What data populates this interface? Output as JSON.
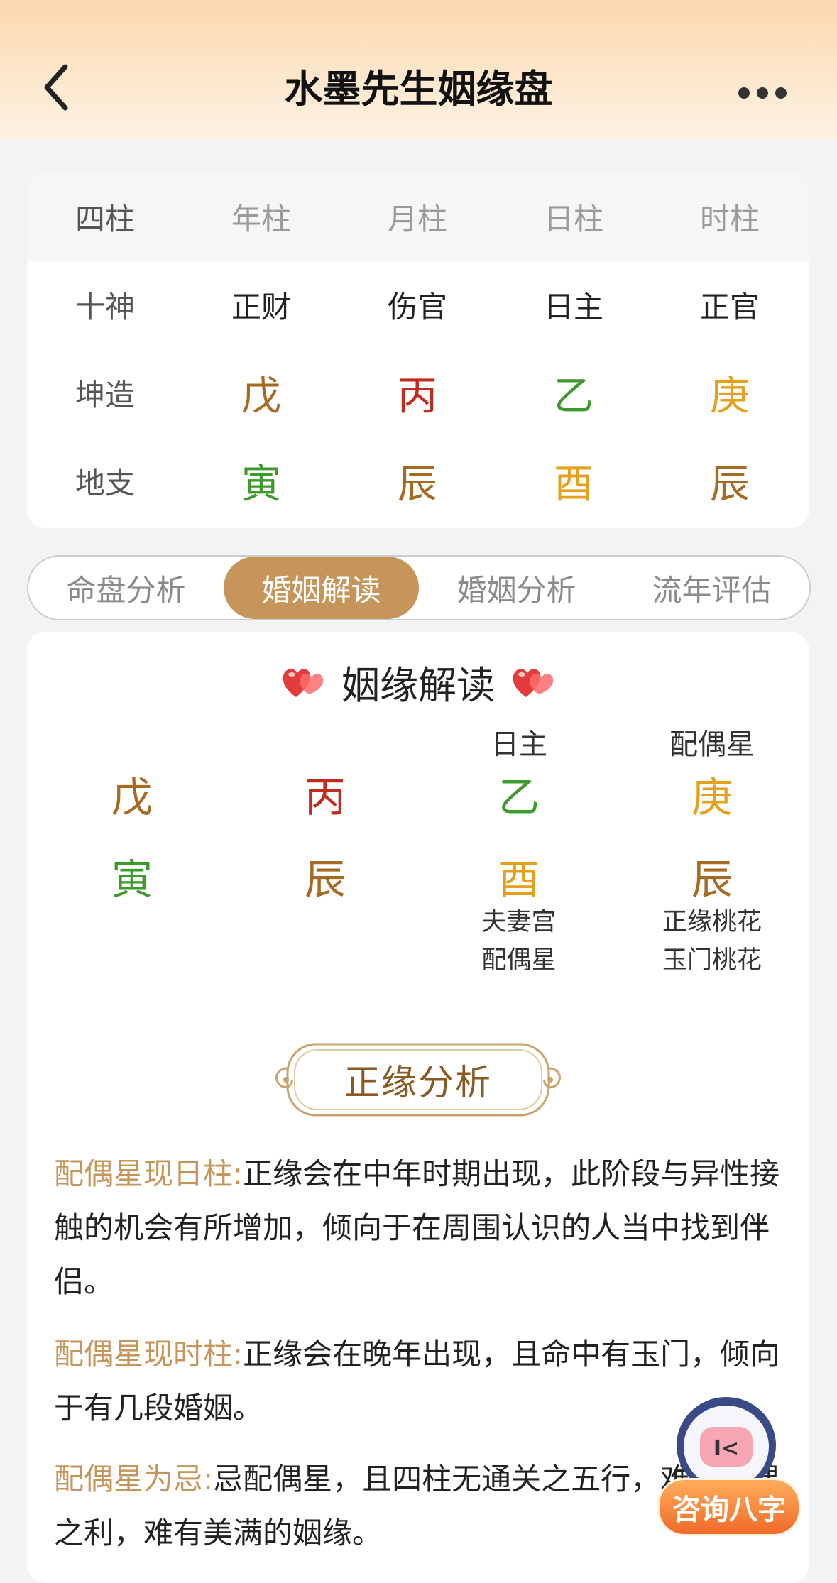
{
  "header": {
    "title": "水墨先生姻缘盘"
  },
  "bazi": {
    "headers": [
      "四柱",
      "年柱",
      "月柱",
      "日柱",
      "时柱"
    ],
    "rows": [
      {
        "label": "十神",
        "cells": [
          "正财",
          "伤官",
          "日主",
          "正官"
        ],
        "colors": [
          "#222222",
          "#222222",
          "#222222",
          "#222222"
        ]
      },
      {
        "label": "坤造",
        "cells": [
          "戊",
          "丙",
          "乙",
          "庚"
        ],
        "colors": [
          "#a66a22",
          "#c42b1f",
          "#3e9a2c",
          "#e6a11c"
        ]
      },
      {
        "label": "地支",
        "cells": [
          "寅",
          "辰",
          "酉",
          "辰"
        ],
        "colors": [
          "#3e9a2c",
          "#a66a22",
          "#e6a11c",
          "#a66a22"
        ]
      }
    ]
  },
  "tabs": [
    "命盘分析",
    "婚姻解读",
    "婚姻分析",
    "流年评估"
  ],
  "yinyuan": {
    "title": "姻缘解读",
    "columns": [
      {
        "top_label": "",
        "stem": "戊",
        "stem_color": "#a66a22",
        "branch": "寅",
        "branch_color": "#3e9a2c",
        "sub1": "",
        "sub2": ""
      },
      {
        "top_label": "",
        "stem": "丙",
        "stem_color": "#c42b1f",
        "branch": "辰",
        "branch_color": "#a66a22",
        "sub1": "",
        "sub2": ""
      },
      {
        "top_label": "日主",
        "stem": "乙",
        "stem_color": "#3e9a2c",
        "branch": "酉",
        "branch_color": "#e6a11c",
        "sub1": "夫妻宫",
        "sub2": "配偶星"
      },
      {
        "top_label": "配偶星",
        "stem": "庚",
        "stem_color": "#e6a11c",
        "branch": "辰",
        "branch_color": "#a66a22",
        "sub1": "正缘桃花",
        "sub2": "玉门桃花"
      }
    ],
    "badge": "正缘分析",
    "paragraphs": [
      {
        "label": "配偶星现日柱:",
        "text": "正缘会在中年时期出现，此阶段与异性接触的机会有所增加，倾向于在周围认识的人当中找到伴侣。"
      },
      {
        "label": "配偶星现时柱:",
        "text": "正缘会在晚年出现，且命中有玉门，倾向于有几段婚姻。"
      },
      {
        "label": "配偶星为忌:",
        "text": "忌配偶星，且四柱无通关之五行，难享配偶之利，难有美满的姻缘。"
      }
    ]
  },
  "fab": {
    "label": "咨询八字"
  },
  "colors": {
    "accent": "#c6955a",
    "header_top": "#fbd8ae"
  }
}
